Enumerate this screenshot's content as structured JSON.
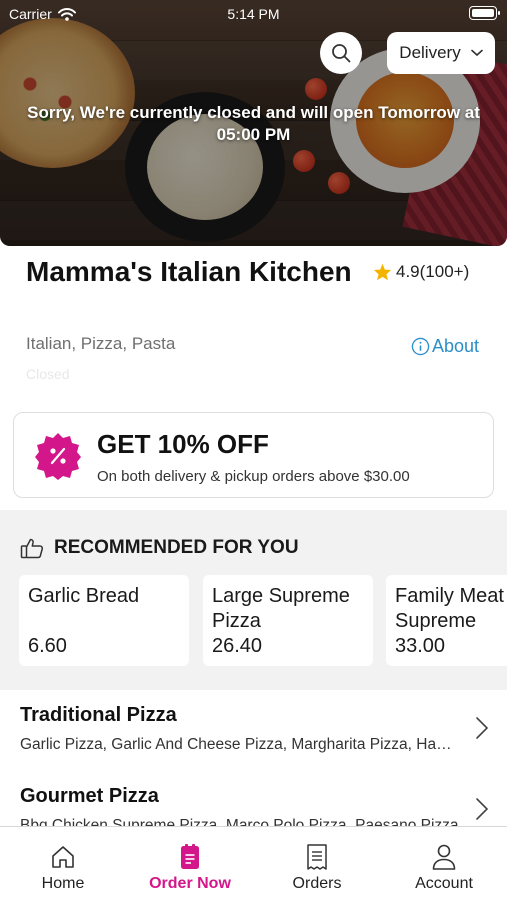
{
  "status_bar": {
    "carrier": "Carrier",
    "time": "5:14 PM"
  },
  "hero": {
    "delivery_mode": "Delivery",
    "closed_message": "Sorry, We're currently closed and will open Tomorrow at 05:00 PM"
  },
  "restaurant": {
    "name": "Mamma's Italian Kitchen",
    "rating": "4.9(100+)",
    "cuisines": "Italian, Pizza, Pasta",
    "about_label": "About",
    "status_text": "Closed"
  },
  "promo": {
    "title": "GET 10% OFF",
    "subtitle": "On both delivery & pickup orders above $30.00"
  },
  "recommended": {
    "heading": "RECOMMENDED FOR YOU",
    "items": [
      {
        "name": "Garlic Bread",
        "price": "6.60"
      },
      {
        "name": "Large Supreme Pizza",
        "price": "26.40"
      },
      {
        "name": "Family Meat Supreme",
        "price": "33.00"
      }
    ]
  },
  "categories": [
    {
      "title": "Traditional Pizza",
      "desc": "Garlic Pizza, Garlic And Cheese Pizza, Margharita Pizza, Hawaiian Pizza"
    },
    {
      "title": "Gourmet Pizza",
      "desc": "Bbq Chicken Supreme Pizza, Marco Polo Pizza, Paesano Pizza"
    }
  ],
  "tabs": [
    {
      "label": "Home",
      "icon": "home-icon"
    },
    {
      "label": "Order Now",
      "icon": "order-icon"
    },
    {
      "label": "Orders",
      "icon": "receipt-icon"
    },
    {
      "label": "Account",
      "icon": "user-icon"
    }
  ],
  "colors": {
    "accent": "#d3168a",
    "link": "#2a8fc9",
    "star": "#f5b301"
  }
}
